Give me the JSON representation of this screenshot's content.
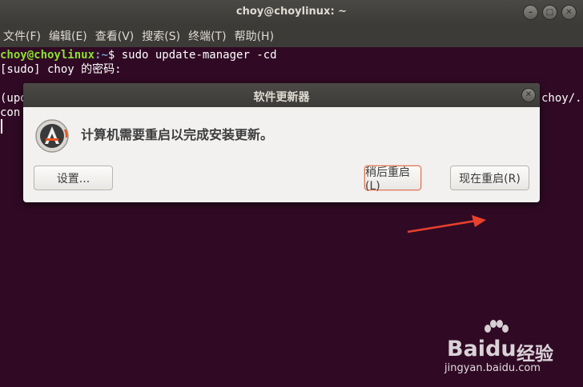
{
  "window": {
    "title": "choy@choylinux: ~",
    "controls": [
      "minimize-icon",
      "maximize-icon",
      "close-icon"
    ]
  },
  "menubar": {
    "items": [
      "文件(F)",
      "编辑(E)",
      "查看(V)",
      "搜索(S)",
      "终端(T)",
      "帮助(H)"
    ]
  },
  "terminal": {
    "prompt_user": "choy@choylinux",
    "prompt_path": ":~",
    "prompt_symbol": "$ ",
    "command": "sudo update-manager -cd",
    "line2": "[sudo] choy 的密码:",
    "line4_left": "(upd",
    "line4_right": "choy/.",
    "line5_left": "con"
  },
  "dialog": {
    "title": "软件更新器",
    "message": "计算机需要重启以完成安装更新。",
    "buttons": {
      "settings": "设置...",
      "restart_later": "稍后重启(L)",
      "restart_now": "现在重启(R)"
    },
    "icon": "software-updater-icon"
  },
  "watermark": {
    "brand": "Bai",
    "brand2": "du",
    "jingyan": "经验",
    "url": "jingyan.baidu.com"
  },
  "colors": {
    "terminal_bg": "#300a24",
    "prompt_user": "#8ae234",
    "prompt_path": "#729fcf",
    "accent": "#e95420",
    "arrow": "#e8412c"
  }
}
